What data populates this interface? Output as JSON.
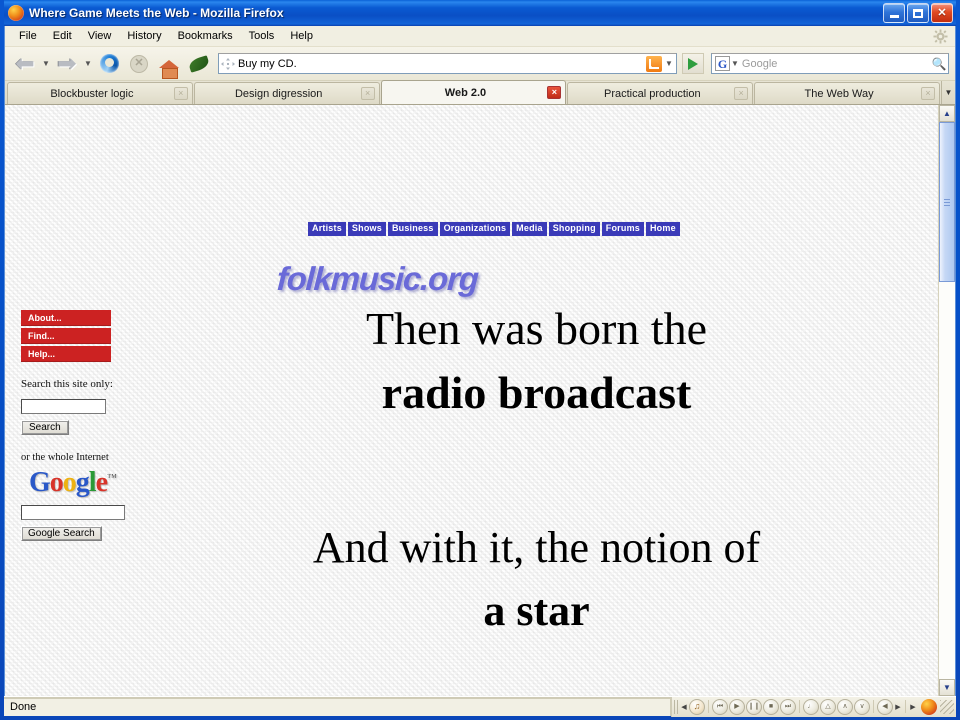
{
  "window": {
    "title": "Where Game Meets the Web - Mozilla Firefox",
    "minimize_label": "Minimize",
    "maximize_label": "Maximize",
    "close_label": "Close"
  },
  "menubar": {
    "items": [
      "File",
      "Edit",
      "View",
      "History",
      "Bookmarks",
      "Tools",
      "Help"
    ],
    "gear_icon": "gear-icon"
  },
  "toolbar": {
    "back_icon": "back-arrow-icon",
    "forward_icon": "forward-arrow-icon",
    "reload_icon": "reload-icon",
    "stop_icon": "stop-icon",
    "home_icon": "home-icon",
    "leaf_icon": "leaf-icon",
    "url_value": "Buy my CD.",
    "url_drag_icon": "drag-move-icon",
    "rss_icon": "rss-feed-icon",
    "go_icon": "go-arrow-icon",
    "search_engine_icon": "google-g-icon",
    "search_engine_letter": "G",
    "search_placeholder": "Google",
    "search_value": "",
    "search_magnifier_icon": "magnifier-icon"
  },
  "tabs": {
    "items": [
      {
        "label": "Blockbuster logic",
        "active": false
      },
      {
        "label": "Design digression",
        "active": false
      },
      {
        "label": "Web 2.0",
        "active": true
      },
      {
        "label": "Practical production",
        "active": false
      },
      {
        "label": "The Web Way",
        "active": false
      }
    ],
    "close_glyph": "×",
    "list_all_icon": "chevron-down-icon"
  },
  "page": {
    "sitenav": [
      "Artists",
      "Shows",
      "Business",
      "Organizations",
      "Media",
      "Shopping",
      "Forums",
      "Home"
    ],
    "logo": "folkmusic.org",
    "sidebar": {
      "buttons": [
        "About...",
        "Find...",
        "Help..."
      ],
      "search_label": "Search this site only:",
      "search_value": "",
      "search_button": "Search",
      "internet_label": "or the whole Internet",
      "google_letters": [
        "G",
        "o",
        "o",
        "g",
        "l",
        "e"
      ],
      "google_tm": "™",
      "google_value": "",
      "google_button": "Google Search"
    },
    "slide": {
      "line1": "Then was born the",
      "line2": "radio broadcast",
      "line3": "And with it, the notion of",
      "line4": "a star"
    },
    "scroll_up_icon": "chevron-up-icon",
    "scroll_down_icon": "chevron-down-icon"
  },
  "statusbar": {
    "status": "Done",
    "media": {
      "note_icon": "music-note-icon",
      "previous_glyph": "⏮",
      "play_glyph": "▶",
      "pause_glyph": "❘❘",
      "stop_glyph": "■",
      "next_glyph": "⏭",
      "eject_glyph": "△",
      "volume_up_glyph": "∧",
      "volume_down_glyph": "∨",
      "speaker_glyph": "◀",
      "overflow_glyph": "▶",
      "firefox_icon": "firefox-icon",
      "resize_grip_icon": "resize-grip-icon"
    }
  }
}
